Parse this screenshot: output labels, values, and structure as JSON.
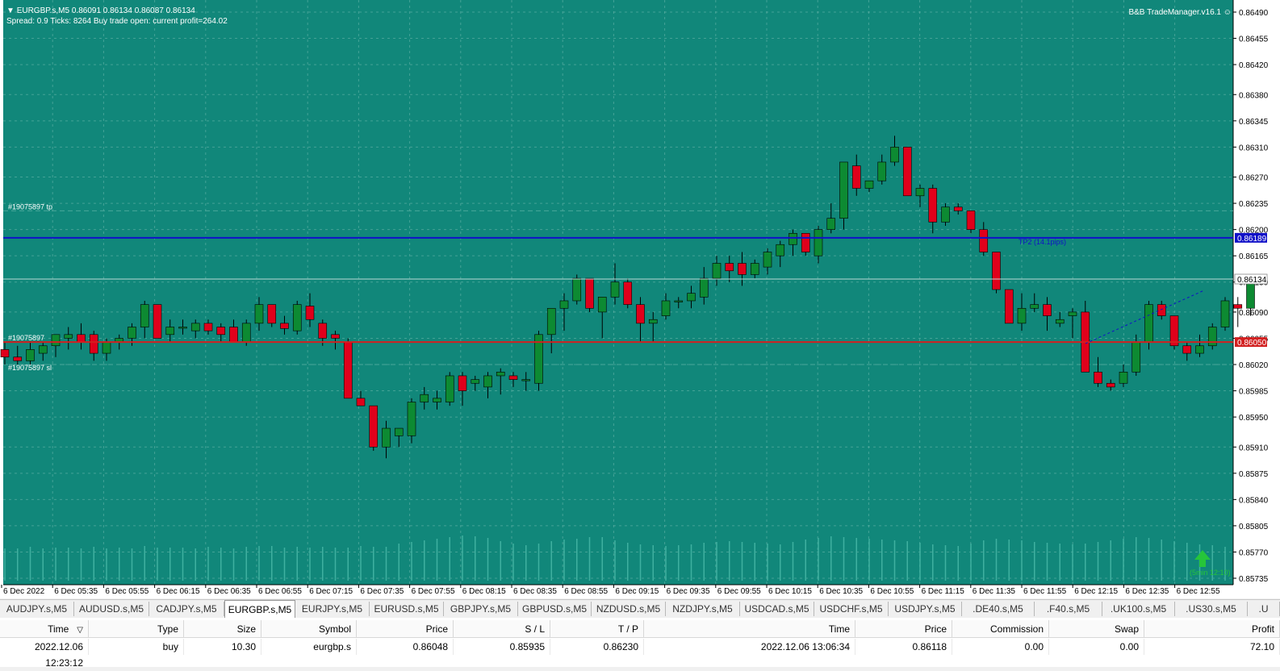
{
  "chart": {
    "symbol_line": "EURGBP.s,M5  0.86091 0.86134 0.86087 0.86134",
    "info_line": "Spread: 0.9   Ticks: 8264   Buy trade open: current profit=264.02",
    "brand": "B&B TradeManager.v16.1",
    "smile_icon": "☺",
    "colors": {
      "background": "#11877a",
      "bull": "#0d8a32",
      "bear": "#e0001b",
      "tp_line": "#1010c8",
      "entry_line": "#d22020",
      "axis_bg": "#ffffff"
    },
    "price_axis": [
      "0.86490",
      "0.86455",
      "0.86420",
      "0.86380",
      "0.86345",
      "0.86310",
      "0.86270",
      "0.86235",
      "0.86200",
      "0.86165",
      "0.86130",
      "0.86090",
      "0.86055",
      "0.86020",
      "0.85985",
      "0.85950",
      "0.85910",
      "0.85875",
      "0.85840",
      "0.85805",
      "0.85770",
      "0.85735"
    ],
    "time_axis": [
      "6 Dec 2022",
      "6 Dec 05:35",
      "6 Dec 05:55",
      "6 Dec 06:15",
      "6 Dec 06:35",
      "6 Dec 06:55",
      "6 Dec 07:15",
      "6 Dec 07:35",
      "6 Dec 07:55",
      "6 Dec 08:15",
      "6 Dec 08:35",
      "6 Dec 08:55",
      "6 Dec 09:15",
      "6 Dec 09:35",
      "6 Dec 09:55",
      "6 Dec 10:15",
      "6 Dec 10:35",
      "6 Dec 10:55",
      "6 Dec 11:15",
      "6 Dec 11:35",
      "6 Dec 11:55",
      "6 Dec 12:15",
      "6 Dec 12:35",
      "6 Dec 12:55"
    ],
    "tp_label": "#19075897 tp",
    "sl_label": "#19075897 sl",
    "entry_label": "#19075897",
    "tp2_label": "TP2 (14.1pips)",
    "tp_price": "0.86189",
    "current_price": "0.86134",
    "entry_price": "0.86050",
    "timer_label": "(5min 12:10)",
    "candles": [
      [
        0.8604,
        0.8605,
        0.8602,
        0.8603
      ],
      [
        0.8603,
        0.86045,
        0.8602,
        0.86025
      ],
      [
        0.86025,
        0.8605,
        0.8602,
        0.8604
      ],
      [
        0.86035,
        0.8605,
        0.86025,
        0.86045
      ],
      [
        0.86045,
        0.8606,
        0.8603,
        0.8606
      ],
      [
        0.86055,
        0.8607,
        0.8604,
        0.8606
      ],
      [
        0.8606,
        0.86075,
        0.8604,
        0.8605
      ],
      [
        0.8606,
        0.86065,
        0.86025,
        0.86035
      ],
      [
        0.86035,
        0.86055,
        0.86025,
        0.8605
      ],
      [
        0.8605,
        0.8606,
        0.8604,
        0.86055
      ],
      [
        0.86055,
        0.86075,
        0.86045,
        0.8607
      ],
      [
        0.8607,
        0.86105,
        0.86055,
        0.861
      ],
      [
        0.861,
        0.861,
        0.86055,
        0.86055
      ],
      [
        0.8606,
        0.8608,
        0.8605,
        0.8607
      ],
      [
        0.8607,
        0.8608,
        0.8606,
        0.8607
      ],
      [
        0.86065,
        0.8608,
        0.86055,
        0.86075
      ],
      [
        0.86075,
        0.8608,
        0.8606,
        0.86065
      ],
      [
        0.8607,
        0.86075,
        0.8605,
        0.8606
      ],
      [
        0.8607,
        0.8608,
        0.8605,
        0.8605
      ],
      [
        0.8605,
        0.8608,
        0.86045,
        0.86075
      ],
      [
        0.86075,
        0.8611,
        0.86065,
        0.861
      ],
      [
        0.861,
        0.861,
        0.8607,
        0.86075
      ],
      [
        0.86075,
        0.86085,
        0.8606,
        0.86068
      ],
      [
        0.86065,
        0.86105,
        0.8606,
        0.861
      ],
      [
        0.86098,
        0.86115,
        0.8607,
        0.8608
      ],
      [
        0.86075,
        0.8608,
        0.86045,
        0.86055
      ],
      [
        0.8606,
        0.86065,
        0.8604,
        0.86055
      ],
      [
        0.8605,
        0.86055,
        0.85975,
        0.85975
      ],
      [
        0.85975,
        0.85985,
        0.85965,
        0.85965
      ],
      [
        0.85965,
        0.85965,
        0.85905,
        0.8591
      ],
      [
        0.8591,
        0.85945,
        0.85895,
        0.85935
      ],
      [
        0.85925,
        0.85935,
        0.8591,
        0.85935
      ],
      [
        0.85925,
        0.85975,
        0.85915,
        0.8597
      ],
      [
        0.8597,
        0.8599,
        0.8596,
        0.8598
      ],
      [
        0.8597,
        0.85985,
        0.8596,
        0.85975
      ],
      [
        0.8597,
        0.8601,
        0.85965,
        0.86005
      ],
      [
        0.86005,
        0.8601,
        0.85965,
        0.85985
      ],
      [
        0.85995,
        0.86005,
        0.85985,
        0.86
      ],
      [
        0.8599,
        0.8601,
        0.85975,
        0.86005
      ],
      [
        0.86005,
        0.86015,
        0.8598,
        0.8601
      ],
      [
        0.86005,
        0.8601,
        0.8599,
        0.86
      ],
      [
        0.86,
        0.8601,
        0.85985,
        0.86
      ],
      [
        0.85995,
        0.86065,
        0.85985,
        0.8606
      ],
      [
        0.8606,
        0.86095,
        0.86035,
        0.86095
      ],
      [
        0.86095,
        0.86115,
        0.86065,
        0.86105
      ],
      [
        0.86105,
        0.8614,
        0.861,
        0.86135
      ],
      [
        0.86135,
        0.86135,
        0.8609,
        0.86095
      ],
      [
        0.8609,
        0.8611,
        0.86055,
        0.8611
      ],
      [
        0.8611,
        0.86155,
        0.861,
        0.8613
      ],
      [
        0.8613,
        0.86135,
        0.86095,
        0.861
      ],
      [
        0.861,
        0.8611,
        0.8605,
        0.86075
      ],
      [
        0.86075,
        0.8609,
        0.8605,
        0.8608
      ],
      [
        0.86085,
        0.86115,
        0.8608,
        0.86105
      ],
      [
        0.86105,
        0.8611,
        0.86095,
        0.86105
      ],
      [
        0.86105,
        0.86125,
        0.86095,
        0.86115
      ],
      [
        0.8611,
        0.8615,
        0.861,
        0.86135
      ],
      [
        0.86135,
        0.86165,
        0.86125,
        0.86155
      ],
      [
        0.86155,
        0.86165,
        0.8613,
        0.86145
      ],
      [
        0.86155,
        0.8617,
        0.86125,
        0.8614
      ],
      [
        0.8614,
        0.8616,
        0.86135,
        0.86155
      ],
      [
        0.8615,
        0.86175,
        0.8614,
        0.8617
      ],
      [
        0.86165,
        0.86185,
        0.8615,
        0.8618
      ],
      [
        0.8618,
        0.862,
        0.86165,
        0.86195
      ],
      [
        0.86195,
        0.86195,
        0.86165,
        0.8617
      ],
      [
        0.86165,
        0.86205,
        0.86155,
        0.862
      ],
      [
        0.862,
        0.86235,
        0.86195,
        0.86215
      ],
      [
        0.86215,
        0.8629,
        0.862,
        0.8629
      ],
      [
        0.86285,
        0.863,
        0.86245,
        0.86255
      ],
      [
        0.86255,
        0.86265,
        0.8625,
        0.86265
      ],
      [
        0.86265,
        0.863,
        0.8626,
        0.8629
      ],
      [
        0.8629,
        0.86325,
        0.86285,
        0.8631
      ],
      [
        0.8631,
        0.8631,
        0.86245,
        0.86245
      ],
      [
        0.86245,
        0.8626,
        0.8623,
        0.86255
      ],
      [
        0.86255,
        0.8626,
        0.86195,
        0.8621
      ],
      [
        0.8621,
        0.86235,
        0.86205,
        0.8623
      ],
      [
        0.8623,
        0.86235,
        0.8622,
        0.86225
      ],
      [
        0.86225,
        0.86225,
        0.86195,
        0.862
      ],
      [
        0.862,
        0.8621,
        0.86165,
        0.8617
      ],
      [
        0.8617,
        0.8617,
        0.86115,
        0.8612
      ],
      [
        0.8612,
        0.8612,
        0.86075,
        0.86075
      ],
      [
        0.86075,
        0.86115,
        0.86065,
        0.86095
      ],
      [
        0.86095,
        0.86115,
        0.8609,
        0.861
      ],
      [
        0.861,
        0.8611,
        0.86065,
        0.86085
      ],
      [
        0.86075,
        0.8609,
        0.8607,
        0.8608
      ],
      [
        0.86085,
        0.86095,
        0.86055,
        0.8609
      ],
      [
        0.8609,
        0.86105,
        0.8601,
        0.8601
      ],
      [
        0.8601,
        0.8603,
        0.8599,
        0.85995
      ],
      [
        0.85995,
        0.86,
        0.85985,
        0.8599
      ],
      [
        0.85995,
        0.8602,
        0.8599,
        0.8601
      ],
      [
        0.8601,
        0.8606,
        0.86005,
        0.8605
      ],
      [
        0.8605,
        0.86105,
        0.8604,
        0.861
      ],
      [
        0.861,
        0.86105,
        0.8608,
        0.86085
      ],
      [
        0.86085,
        0.86085,
        0.8604,
        0.86045
      ],
      [
        0.86045,
        0.8605,
        0.86025,
        0.86035
      ],
      [
        0.86035,
        0.8606,
        0.8603,
        0.86045
      ],
      [
        0.86045,
        0.86075,
        0.8604,
        0.8607
      ],
      [
        0.8607,
        0.8611,
        0.86065,
        0.86105
      ],
      [
        0.861,
        0.8611,
        0.8607,
        0.86095
      ],
      [
        0.86095,
        0.8614,
        0.86085,
        0.86134
      ]
    ],
    "volumes": [
      40,
      40,
      42,
      40,
      41,
      41,
      40,
      42,
      40,
      41,
      40,
      43,
      41,
      41,
      41,
      40,
      42,
      41,
      40,
      42,
      43,
      43,
      41,
      42,
      41,
      42,
      41,
      41,
      43,
      42,
      42,
      46,
      48,
      50,
      52,
      54,
      56,
      55,
      53,
      49,
      46,
      44,
      46,
      49,
      51,
      52,
      54,
      54,
      50,
      47,
      45,
      44,
      43,
      44,
      45,
      47,
      48,
      49,
      48,
      47,
      46,
      45,
      48,
      51,
      53,
      55,
      54,
      53,
      52,
      51,
      50,
      49,
      47,
      45,
      44,
      43,
      46,
      50,
      52,
      51,
      50,
      48,
      47,
      46,
      45,
      46,
      48,
      50,
      52,
      54,
      53,
      51,
      49,
      47,
      45,
      44,
      42
    ]
  },
  "tabs": [
    {
      "label": "AUDJPY.s,M5",
      "active": false
    },
    {
      "label": "AUDUSD.s,M5",
      "active": false
    },
    {
      "label": "CADJPY.s,M5",
      "active": false
    },
    {
      "label": "EURGBP.s,M5",
      "active": true
    },
    {
      "label": "EURJPY.s,M5",
      "active": false
    },
    {
      "label": "EURUSD.s,M5",
      "active": false
    },
    {
      "label": "GBPJPY.s,M5",
      "active": false
    },
    {
      "label": "GBPUSD.s,M5",
      "active": false
    },
    {
      "label": "NZDUSD.s,M5",
      "active": false
    },
    {
      "label": "NZDJPY.s,M5",
      "active": false
    },
    {
      "label": "USDCAD.s,M5",
      "active": false
    },
    {
      "label": "USDCHF.s,M5",
      "active": false
    },
    {
      "label": "USDJPY.s,M5",
      "active": false
    },
    {
      "label": ".DE40.s,M5",
      "active": false
    },
    {
      "label": ".F40.s,M5",
      "active": false
    },
    {
      "label": ".UK100.s,M5",
      "active": false
    },
    {
      "label": ".US30.s,M5",
      "active": false
    },
    {
      "label": ".U",
      "active": false
    }
  ],
  "trades": {
    "headers": [
      "Time",
      "Type",
      "Size",
      "Symbol",
      "Price",
      "S / L",
      "T / P",
      "Time",
      "Price",
      "Commission",
      "Swap",
      "Profit"
    ],
    "sort_icon": "▽",
    "row": [
      "2022.12.06 12:23:12",
      "buy",
      "10.30",
      "eurgbp.s",
      "0.86048",
      "0.85935",
      "0.86230",
      "2022.12.06 13:06:34",
      "0.86118",
      "0.00",
      "0.00",
      "72.10"
    ]
  }
}
